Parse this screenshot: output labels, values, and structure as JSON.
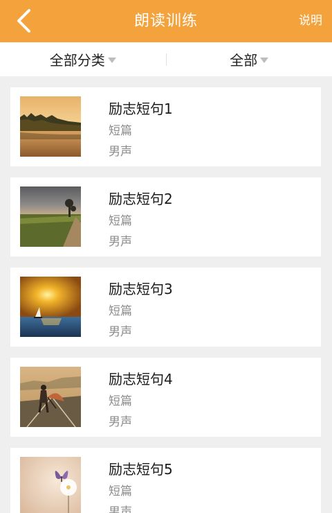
{
  "header": {
    "title": "朗读训练",
    "help_label": "说明",
    "bg_color": "#f4a23c"
  },
  "filters": {
    "category_label": "全部分类",
    "scope_label": "全部"
  },
  "items": [
    {
      "title": "励志短句1",
      "type": "短篇",
      "voice": "男声",
      "image": "lake-sunset"
    },
    {
      "title": "励志短句2",
      "type": "短篇",
      "voice": "男声",
      "image": "field-road"
    },
    {
      "title": "励志短句3",
      "type": "短篇",
      "voice": "男声",
      "image": "sailboat-sunset"
    },
    {
      "title": "励志短句4",
      "type": "短篇",
      "voice": "男声",
      "image": "woman-umbrella-road"
    },
    {
      "title": "励志短句5",
      "type": "短篇",
      "voice": "男声",
      "image": "butterfly-flower"
    }
  ]
}
